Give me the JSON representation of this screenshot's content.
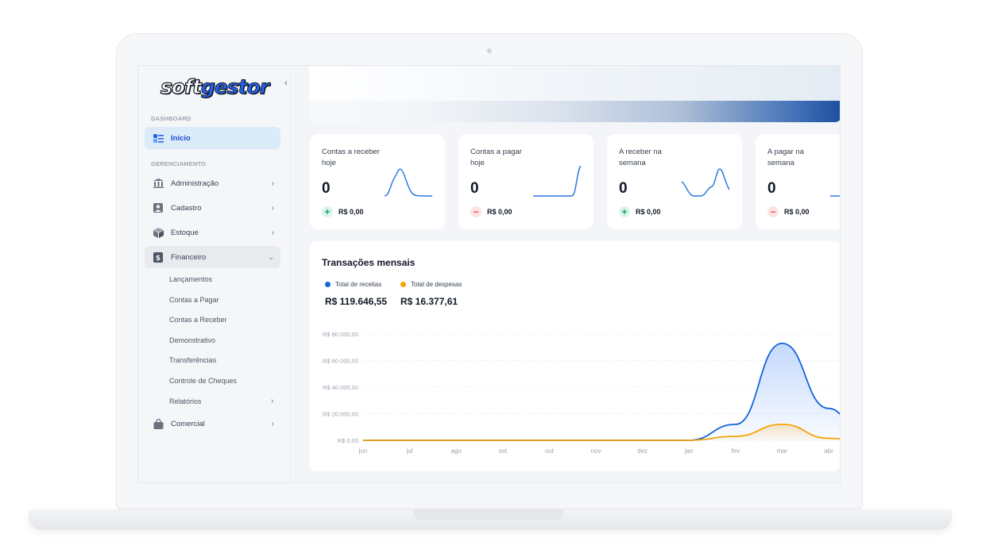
{
  "logo": {
    "part1": "soft",
    "part2": "gestor"
  },
  "sidebar": {
    "collapse_icon": "chevron-left-icon",
    "section_dashboard": "DASHBOARD",
    "section_management": "GERENCIAMENTO",
    "items": [
      {
        "label": "Início",
        "icon": "dashboard-icon"
      },
      {
        "label": "Administração",
        "icon": "bank-icon"
      },
      {
        "label": "Cadastro",
        "icon": "user-card-icon"
      },
      {
        "label": "Estoque",
        "icon": "box-icon"
      },
      {
        "label": "Financeiro",
        "icon": "money-icon"
      },
      {
        "label": "Comercial",
        "icon": "shopping-bag-icon"
      }
    ],
    "financeiro_sub": [
      "Lançamentos",
      "Contas a Pagar",
      "Contas a Receber",
      "Demonstrativo",
      "Transferências",
      "Controle de Cheques",
      "Relatórios"
    ]
  },
  "cards": [
    {
      "title": "Contas a receber hoje",
      "value": "0",
      "sign": "plus",
      "amount": "R$ 0,00"
    },
    {
      "title": "Contas a pagar hoje",
      "value": "0",
      "sign": "minus",
      "amount": "R$ 0,00"
    },
    {
      "title": "A receber na semana",
      "value": "0",
      "sign": "plus",
      "amount": "R$ 0,00"
    },
    {
      "title": "A pagar na semana",
      "value": "0",
      "sign": "minus",
      "amount": "R$ 0,00"
    }
  ],
  "chart_panel": {
    "title": "Transações mensais",
    "legend": [
      {
        "name": "Total de receitas",
        "color": "#1565d8",
        "total": "R$ 119.646,55"
      },
      {
        "name": "Total de despesas",
        "color": "#f5a30a",
        "total": "R$ 16.377,61"
      }
    ]
  },
  "chart_data": {
    "type": "area",
    "categories": [
      "jun",
      "jul",
      "ago",
      "set",
      "out",
      "nov",
      "dez",
      "jan",
      "fev",
      "mar",
      "abr"
    ],
    "series": [
      {
        "name": "Total de receitas",
        "values": [
          0,
          0,
          0,
          0,
          0,
          0,
          0,
          0,
          12000,
          73000,
          24000
        ]
      },
      {
        "name": "Total de despesas",
        "values": [
          0,
          0,
          0,
          0,
          0,
          0,
          0,
          0,
          3000,
          12000,
          1500
        ]
      }
    ],
    "y_ticks": [
      "R$ 0,00",
      "R$ 20.000,00",
      "R$ 40.000,00",
      "R$ 60.000,00",
      "R$ 80.000,00"
    ],
    "ylim": [
      0,
      80000
    ],
    "grid": true,
    "legend_position": "top-left"
  }
}
